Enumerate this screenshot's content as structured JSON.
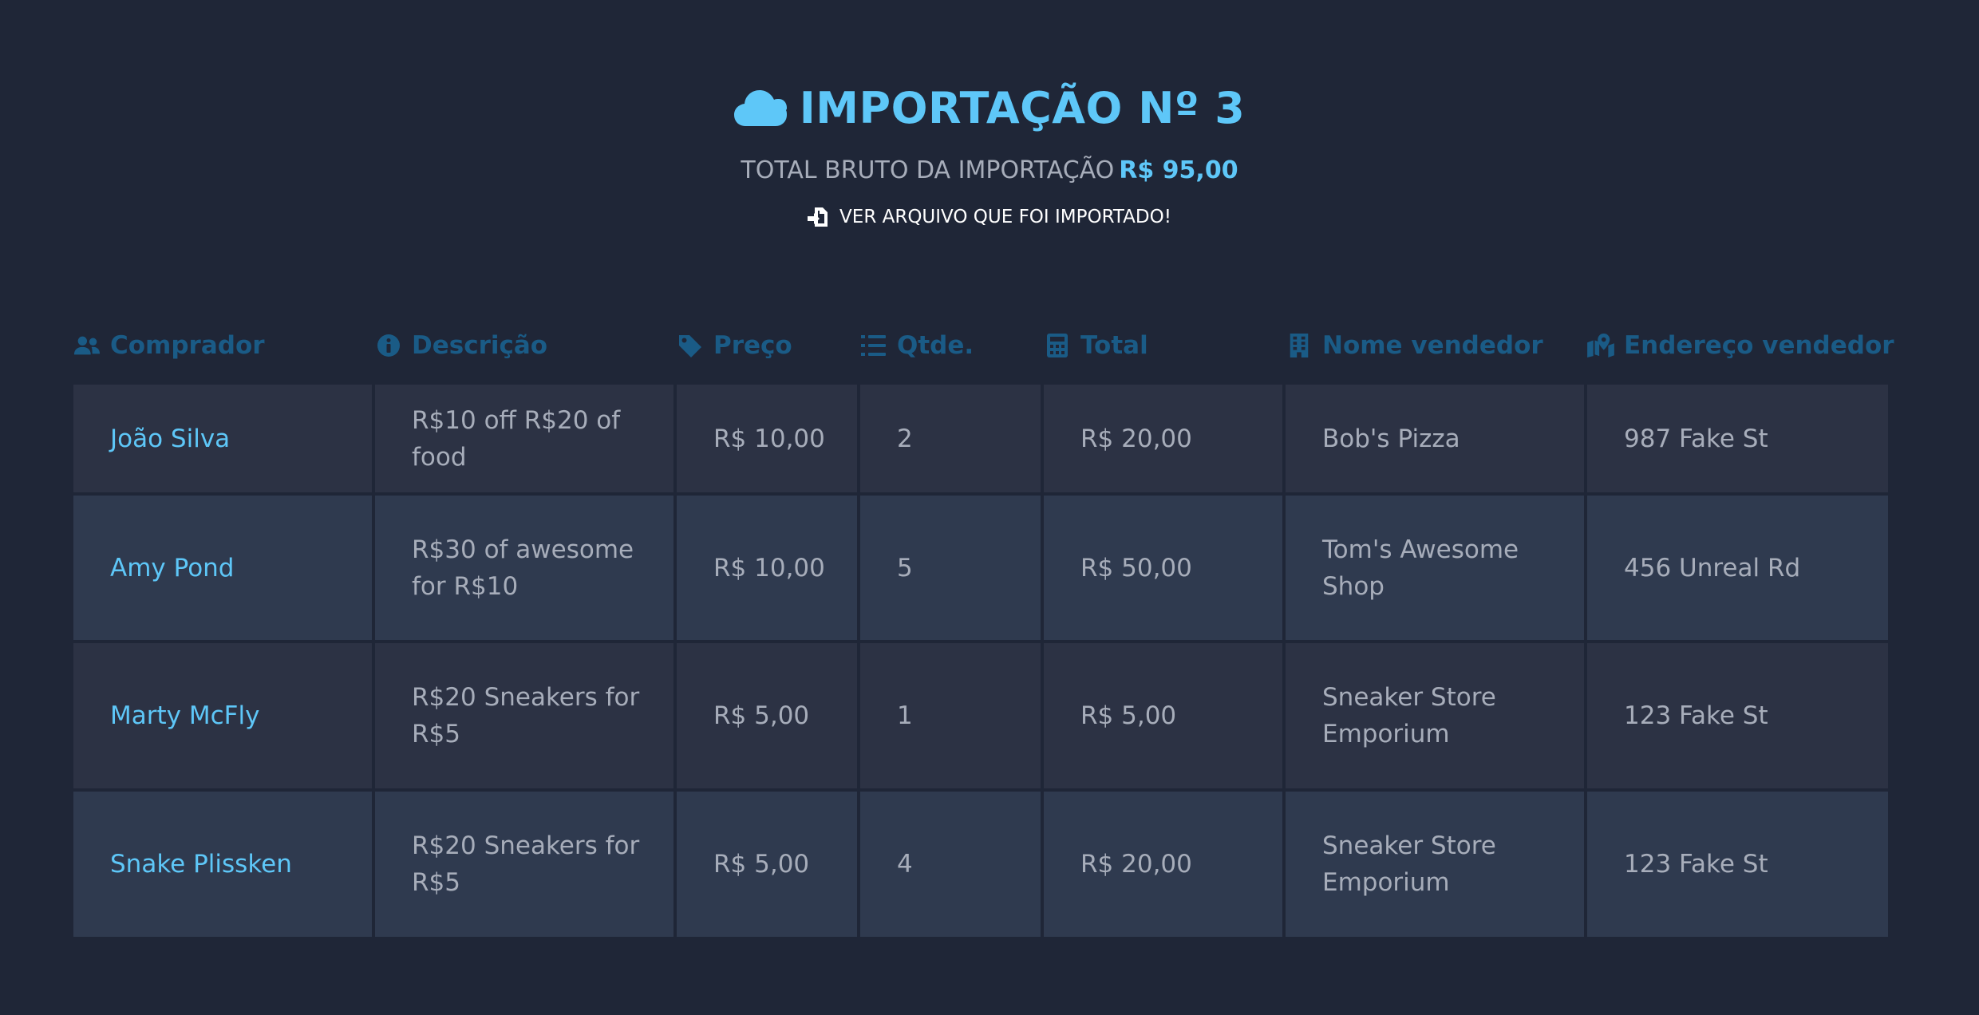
{
  "header": {
    "title": "IMPORTAÇÃO Nº 3",
    "subtitle_label": "TOTAL BRUTO DA IMPORTAÇÃO",
    "subtitle_amount": "R$ 95,00",
    "file_link": "VER ARQUIVO QUE FOI IMPORTADO!"
  },
  "table": {
    "columns": [
      {
        "label": "Comprador",
        "icon": "users-icon"
      },
      {
        "label": "Descrição",
        "icon": "info-circle-icon"
      },
      {
        "label": "Preço",
        "icon": "tag-icon"
      },
      {
        "label": "Qtde.",
        "icon": "list-ol-icon"
      },
      {
        "label": "Total",
        "icon": "calculator-icon"
      },
      {
        "label": "Nome vendedor",
        "icon": "building-icon"
      },
      {
        "label": "Endereço vendedor",
        "icon": "map-marked-icon"
      }
    ],
    "rows": [
      {
        "comprador": "João Silva",
        "descricao": "R$10 off R$20 of food",
        "preco": "R$ 10,00",
        "qtde": "2",
        "total": "R$ 20,00",
        "vendedor": "Bob's Pizza",
        "endereco": "987 Fake St"
      },
      {
        "comprador": "Amy Pond",
        "descricao": "R$30 of awesome for R$10",
        "preco": "R$ 10,00",
        "qtde": "5",
        "total": "R$ 50,00",
        "vendedor": "Tom's Awesome Shop",
        "endereco": "456 Unreal Rd"
      },
      {
        "comprador": "Marty McFly",
        "descricao": "R$20 Sneakers for R$5",
        "preco": "R$ 5,00",
        "qtde": "1",
        "total": "R$ 5,00",
        "vendedor": "Sneaker Store Emporium",
        "endereco": "123 Fake St"
      },
      {
        "comprador": "Snake Plissken",
        "descricao": "R$20 Sneakers for R$5",
        "preco": "R$ 5,00",
        "qtde": "4",
        "total": "R$ 20,00",
        "vendedor": "Sneaker Store Emporium",
        "endereco": "123 Fake St"
      }
    ]
  },
  "colors": {
    "background": "#1f2637",
    "accent": "#5ec7f8",
    "header_text": "#1a5b86",
    "cell_text": "#a7adba",
    "row_odd": "#2c3244",
    "row_even": "#2f3a4f"
  }
}
